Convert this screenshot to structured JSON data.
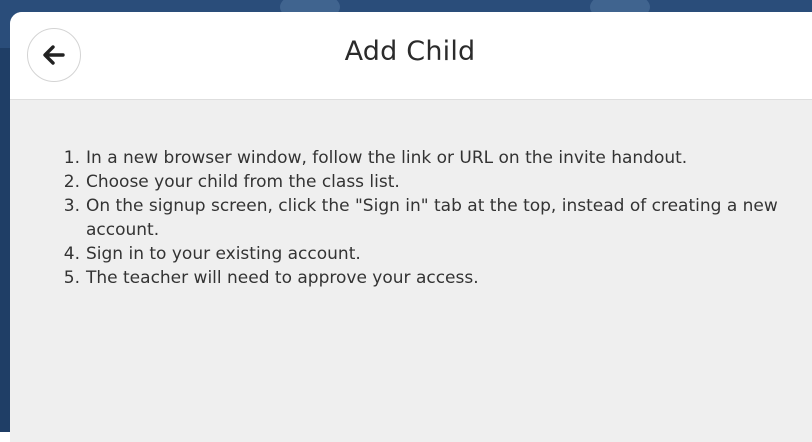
{
  "modal": {
    "title": "Add Child",
    "back_icon": "arrow-left-icon",
    "steps": [
      "In a new browser window, follow the link or URL on the invite handout.",
      "Choose your child from the class list.",
      "On the signup screen, click the \"Sign in\" tab at the top, instead of creating a new account.",
      "Sign in to your existing account.",
      "The teacher will need to approve your access."
    ]
  },
  "colors": {
    "header_bg": "#ffffff",
    "body_bg": "#efefef",
    "backdrop": "#1f3e66"
  }
}
